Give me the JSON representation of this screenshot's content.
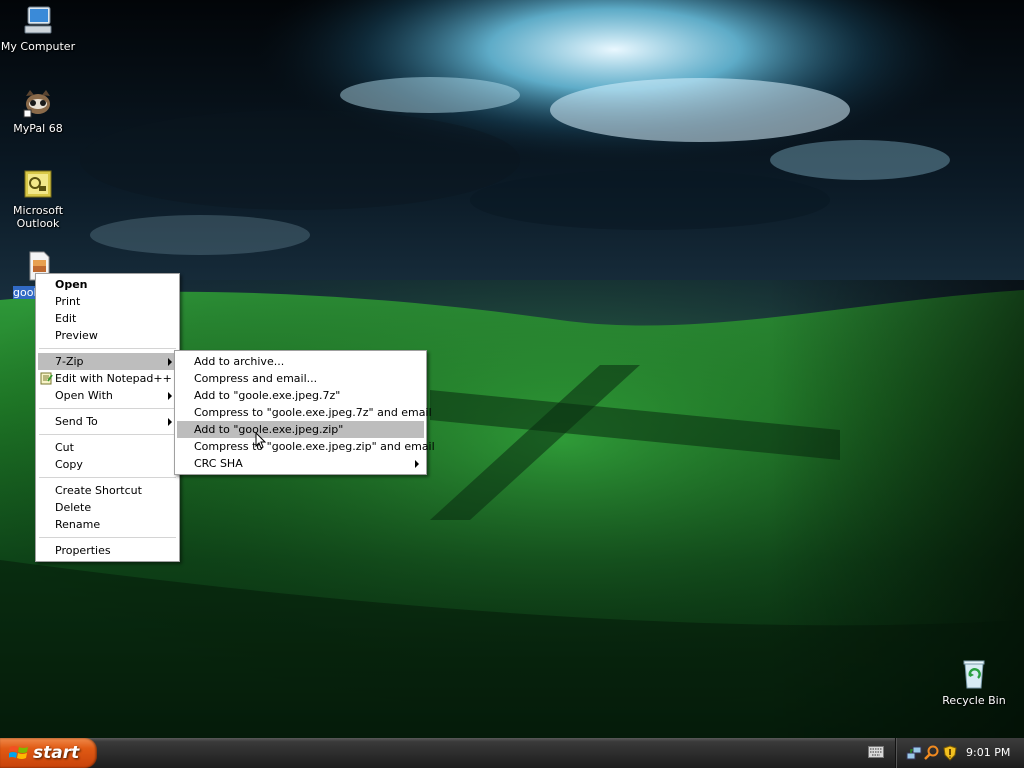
{
  "desktop": {
    "icons": [
      {
        "label": "My Computer",
        "icon": "my-computer-icon"
      },
      {
        "label": "MyPal 68",
        "icon": "mypal-icon"
      },
      {
        "label": "Microsoft Outlook",
        "icon": "outlook-icon"
      },
      {
        "label": "gool",
        "icon": "jpeg-file-icon"
      },
      {
        "label": "Recycle Bin",
        "icon": "recycle-bin-icon"
      }
    ]
  },
  "context_menu": {
    "items": {
      "open": "Open",
      "print": "Print",
      "edit": "Edit",
      "preview": "Preview",
      "seven_zip": "7-Zip",
      "edit_notepad": "Edit with Notepad++",
      "open_with": "Open With",
      "send_to": "Send To",
      "cut": "Cut",
      "copy": "Copy",
      "create_shortcut": "Create Shortcut",
      "delete": "Delete",
      "rename": "Rename",
      "properties": "Properties"
    },
    "highlighted": "7-Zip"
  },
  "seven_zip_menu": {
    "items": {
      "add_archive": "Add to archive...",
      "compress_email": "Compress and email...",
      "add_7z": "Add to \"goole.exe.jpeg.7z\"",
      "compress_7z_email": "Compress to \"goole.exe.jpeg.7z\" and email",
      "add_zip": "Add to \"goole.exe.jpeg.zip\"",
      "compress_zip_email": "Compress to \"goole.exe.jpeg.zip\" and email",
      "crc_sha": "CRC SHA"
    },
    "highlighted": "Add to \"goole.exe.jpeg.zip\""
  },
  "taskbar": {
    "start_label": "start",
    "clock": "9:01 PM",
    "tray_icons": [
      "network-icon",
      "search-icon",
      "security-shield-icon"
    ]
  },
  "colors": {
    "start_button": "#e05a14",
    "menu_highlight": "#bdbdbd",
    "taskbar": "#2a2a2a"
  }
}
